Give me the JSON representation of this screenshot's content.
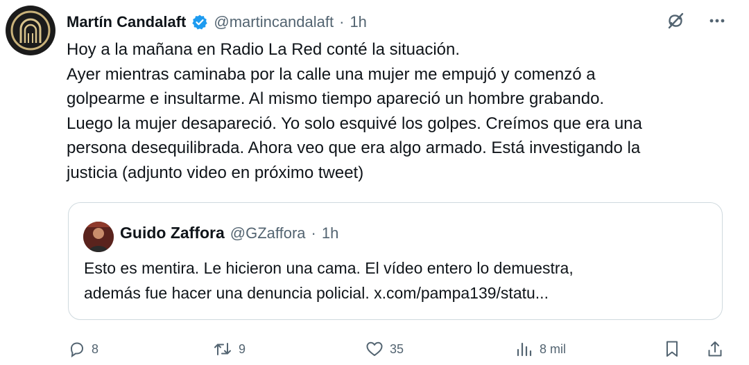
{
  "post": {
    "author_name": "Martín Candalaft",
    "handle": "@martincandalaft",
    "separator": "·",
    "time": "1h",
    "body_lines": [
      "Hoy a la mañana en Radio La Red conté la situación.",
      "Ayer mientras caminaba por la calle una mujer me empujó y comenzó a",
      "golpearme e insultarme. Al mismo tiempo apareció un hombre grabando.",
      "Luego la mujer desapareció. Yo solo esquivé los golpes. Creímos que era una",
      "persona desequilibrada. Ahora veo que era algo armado. Está investigando la",
      "justicia (adjunto video en próximo tweet)"
    ]
  },
  "quote": {
    "author_name": "Guido Zaffora",
    "handle": "@GZaffora",
    "separator": "·",
    "time": "1h",
    "body_lines": [
      "Esto es mentira. Le hicieron una cama. El vídeo entero lo demuestra,",
      "además fue hacer una denuncia policial. x.com/pampa139/statu..."
    ]
  },
  "actions": {
    "replies": "8",
    "reposts": "9",
    "likes": "35",
    "views": "8 mil"
  },
  "icons": {
    "verified": "verified-badge-icon",
    "grok": "grok-icon",
    "more": "more-icon",
    "reply": "reply-icon",
    "repost": "repost-icon",
    "like": "like-icon",
    "views": "views-icon",
    "bookmark": "bookmark-icon",
    "share": "share-icon"
  },
  "colors": {
    "verified": "#1d9bf0",
    "text": "#0f1419",
    "muted": "#536471",
    "border": "#cfd9de"
  }
}
